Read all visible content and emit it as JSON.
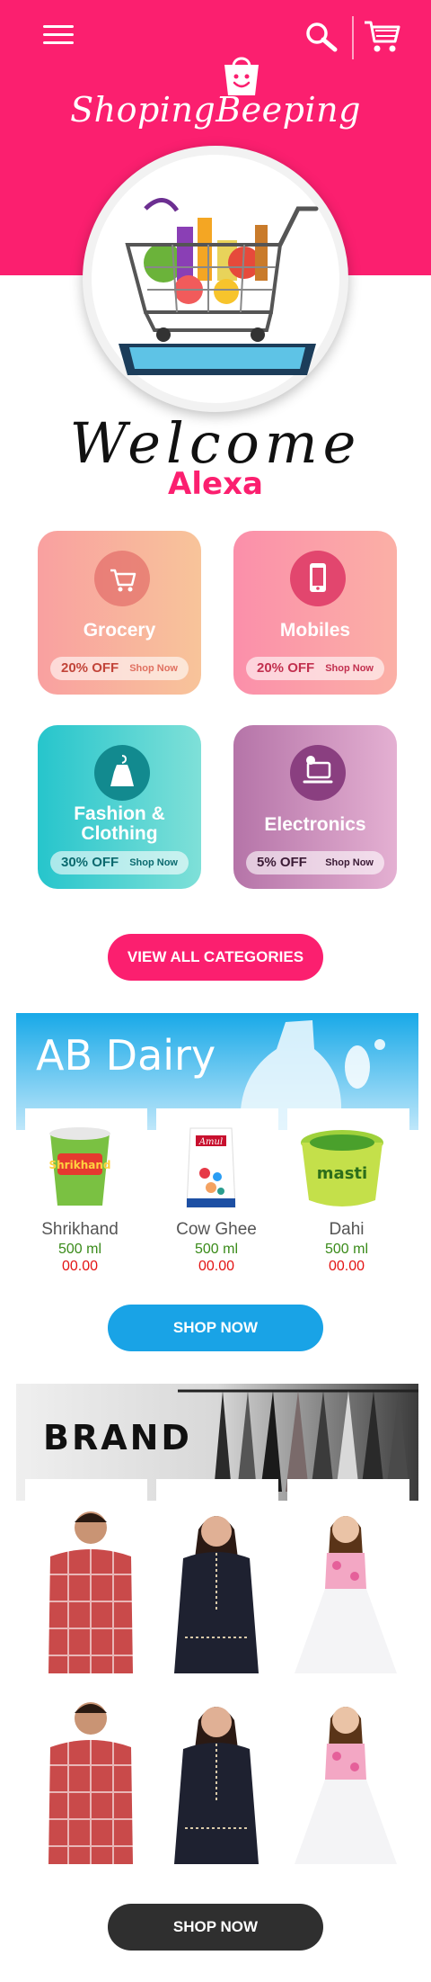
{
  "header": {
    "brand_name": "ShopingBeeping",
    "menu_icon": "menu-icon",
    "search_icon": "search-icon",
    "cart_icon": "cart-icon",
    "accent_color": "#fb1f6f"
  },
  "greeting": {
    "welcome_text": "Welcome",
    "user_name": "Alexa"
  },
  "categories": [
    {
      "label": "Grocery",
      "discount": "20% OFF",
      "action": "Shop Now",
      "icon": "cart-icon"
    },
    {
      "label": "Mobiles",
      "discount": "20% OFF",
      "action": "Shop Now",
      "icon": "mobile-icon"
    },
    {
      "label": "Fashion & Clothing",
      "discount": "30% OFF",
      "action": "Shop Now",
      "icon": "dress-hanger-icon"
    },
    {
      "label": "Electronics",
      "discount": "5% OFF",
      "action": "Shop Now",
      "icon": "laptop-icon"
    }
  ],
  "view_all_label": "VIEW ALL CATEGORIES",
  "dairy": {
    "title": "AB Dairy",
    "products": [
      {
        "name": "Shrikhand",
        "qty": "500 ml",
        "price": "00.00",
        "brand_text": "Shrikhand"
      },
      {
        "name": "Cow Ghee",
        "qty": "500 ml",
        "price": "00.00",
        "brand_text": "Amul"
      },
      {
        "name": "Dahi",
        "qty": "500 ml",
        "price": "00.00",
        "brand_text": "masti"
      }
    ],
    "shop_label": "SHOP NOW"
  },
  "brand": {
    "title": "BRAND",
    "shop_label": "SHOP NOW"
  }
}
